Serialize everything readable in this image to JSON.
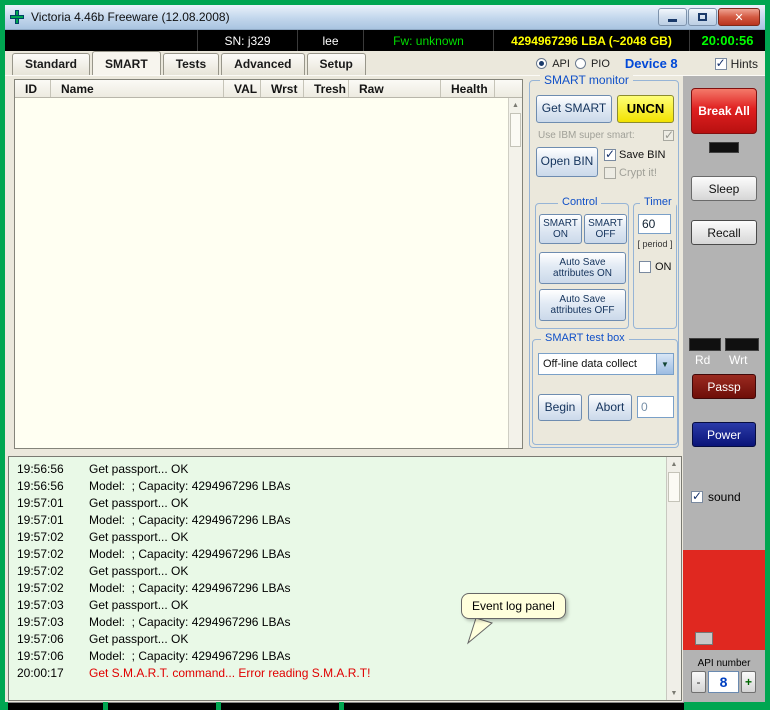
{
  "window": {
    "title": "Victoria 4.46b Freeware (12.08.2008)"
  },
  "infobar": {
    "sn": "SN: j329",
    "name": "lee",
    "fw": "Fw: unknown",
    "lba": "4294967296 LBA (~2048 GB)",
    "clock": "20:00:56"
  },
  "tabbar": {
    "tabs": [
      {
        "label": "Standard",
        "active": false
      },
      {
        "label": "SMART",
        "active": true
      },
      {
        "label": "Tests",
        "active": false
      },
      {
        "label": "Advanced",
        "active": false
      },
      {
        "label": "Setup",
        "active": false
      }
    ],
    "api_label": "API",
    "pio_label": "PIO",
    "device_label": "Device 8",
    "hints_label": "Hints"
  },
  "table": {
    "columns": [
      "ID",
      "Name",
      "VAL",
      "Wrst",
      "Tresh",
      "Raw",
      "Health"
    ]
  },
  "smart_monitor": {
    "title": "SMART monitor",
    "get_smart_button": "Get SMART",
    "uncn_button": "UNCN",
    "ibm_checkbox_label": "Use IBM super smart:",
    "open_bin_button": "Open BIN",
    "save_bin_label": "Save BIN",
    "crypt_label": "Crypt it!",
    "control_group": "Control",
    "smart_on_button": "SMART ON",
    "smart_off_button": "SMART OFF",
    "autosave_on_button": "Auto Save attributes ON",
    "autosave_off_button": "Auto Save attributes OFF",
    "timer_group": "Timer",
    "timer_value": "60",
    "timer_period_label": "[ period ]",
    "timer_on_label": "ON",
    "testbox_group": "SMART test box",
    "test_mode_value": "Off-line data collect",
    "begin_button": "Begin",
    "abort_button": "Abort",
    "test_counter_value": "0"
  },
  "right_panel": {
    "break_all_button": "Break All",
    "sleep_button": "Sleep",
    "recall_button": "Recall",
    "rd_label": "Rd",
    "wrt_label": "Wrt",
    "passp_button": "Passp",
    "power_button": "Power",
    "sound_label": "sound",
    "api_number_label": "API number",
    "api_number_value": "8",
    "spinner_minus": "-",
    "spinner_plus": "+"
  },
  "log": {
    "tooltip": "Event log panel",
    "lines": [
      {
        "time": "19:56:56",
        "text": "Get passport... OK",
        "error": false
      },
      {
        "time": "19:56:56",
        "text": "Model:  ; Capacity: 4294967296 LBAs",
        "error": false
      },
      {
        "time": "19:57:01",
        "text": "Get passport... OK",
        "error": false
      },
      {
        "time": "19:57:01",
        "text": "Model:  ; Capacity: 4294967296 LBAs",
        "error": false
      },
      {
        "time": "19:57:02",
        "text": "Get passport... OK",
        "error": false
      },
      {
        "time": "19:57:02",
        "text": "Model:  ; Capacity: 4294967296 LBAs",
        "error": false
      },
      {
        "time": "19:57:02",
        "text": "Get passport... OK",
        "error": false
      },
      {
        "time": "19:57:02",
        "text": "Model:  ; Capacity: 4294967296 LBAs",
        "error": false
      },
      {
        "time": "19:57:03",
        "text": "Get passport... OK",
        "error": false
      },
      {
        "time": "19:57:03",
        "text": "Model:  ; Capacity: 4294967296 LBAs",
        "error": false
      },
      {
        "time": "19:57:06",
        "text": "Get passport... OK",
        "error": false
      },
      {
        "time": "19:57:06",
        "text": "Model:  ; Capacity: 4294967296 LBAs",
        "error": false
      },
      {
        "time": "20:00:17",
        "text": "Get S.M.A.R.T. command... Error reading S.M.A.R.T!",
        "error": true
      }
    ]
  },
  "colors": {
    "frame_green": "#00A651",
    "log_background": "#E9F9E7",
    "error_red": "#E00000",
    "clock_green": "#00FF00",
    "capacity_yellow": "#FFFF00",
    "firmware_green": "#00DD00",
    "break_all_red": "#D42020",
    "uncn_yellow": "#FFFF00",
    "power_navy": "#101A80",
    "passp_maroon": "#7D1410",
    "device_blue": "#0048D8"
  }
}
